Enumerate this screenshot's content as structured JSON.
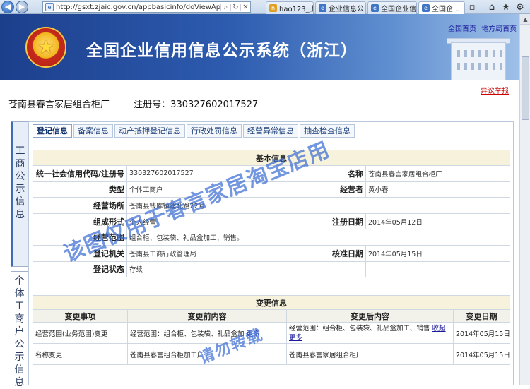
{
  "browser": {
    "url": "http://gsxt.zjaic.gov.cn/appbasicinfo/doViewAppBas",
    "tabs": [
      {
        "label": "hao123_上..."
      },
      {
        "label": "企业信息公..."
      },
      {
        "label": "全国企业信..."
      },
      {
        "label": "全国企..."
      }
    ]
  },
  "banner": {
    "title": "全国企业信用信息公示系统（浙江）",
    "link_home": "全国首页",
    "link_local": "地方局首页"
  },
  "objection_link": "异议举报",
  "company": {
    "name": "苍南县春言家居组合柜厂",
    "reg_label": "注册号：",
    "reg_no": "330327602017527"
  },
  "side_tabs": {
    "a": [
      "工",
      "商",
      "公",
      "示",
      "信",
      "息"
    ],
    "b": [
      "个",
      "体",
      "工",
      "商",
      "户",
      "公",
      "示",
      "信",
      "息"
    ]
  },
  "tabs": [
    "登记信息",
    "备案信息",
    "动产抵押登记信息",
    "行政处罚信息",
    "经营异常信息",
    "抽查检查信息"
  ],
  "basic_info": {
    "section_title": "基本信息",
    "rows": [
      {
        "k1": "统一社会信用代码/注册号",
        "v1": "330327602017527",
        "k2": "名称",
        "v2": "苍南县春言家居组合柜厂"
      },
      {
        "k1": "类型",
        "v1": "个体工商户",
        "k2": "经营者",
        "v2": "黄小春"
      },
      {
        "k1": "经营场所",
        "v1": "苍南县钱库镇建北路22号",
        "k2": "",
        "v2": ""
      },
      {
        "k1": "组成形式",
        "v1": "个人经营",
        "k2": "注册日期",
        "v2": "2014年05月12日"
      },
      {
        "k1": "经营范围",
        "v1": "组合柜、包装袋、礼品盒加工、销售。",
        "k2": "",
        "v2": ""
      },
      {
        "k1": "登记机关",
        "v1": "苍南县工商行政管理局",
        "k2": "核准日期",
        "v2": "2014年05月15日"
      },
      {
        "k1": "登记状态",
        "v1": "存续",
        "k2": "",
        "v2": ""
      }
    ]
  },
  "change_info": {
    "section_title": "变更信息",
    "headers": [
      "变更事项",
      "变更前内容",
      "变更后内容",
      "变更日期"
    ],
    "rows": [
      {
        "item": "经营范围(业务范围)变更",
        "before": "经营范围：组合柜、包装袋、礼品盒加",
        "before_link": "更多",
        "after": "经营范围：组合柜、包装袋、礼品盒加工、销售",
        "after_link": "收起更多",
        "date": "2014年05月15日"
      },
      {
        "item": "名称变更",
        "before": "苍南县春言组合柜加工厂",
        "before_link": "",
        "after": "苍南县春言家居组合柜厂",
        "after_link": "",
        "date": "2014年05月15日"
      }
    ]
  },
  "watermarks": {
    "main": "该图仅用于春言家居淘宝店用",
    "secondary": "请勿转载"
  },
  "colors": {
    "banner": "#2e5cb0",
    "section_bg": "#f6f2dc",
    "link": "#1a1a9a",
    "watermark": "#3c6ed2"
  }
}
